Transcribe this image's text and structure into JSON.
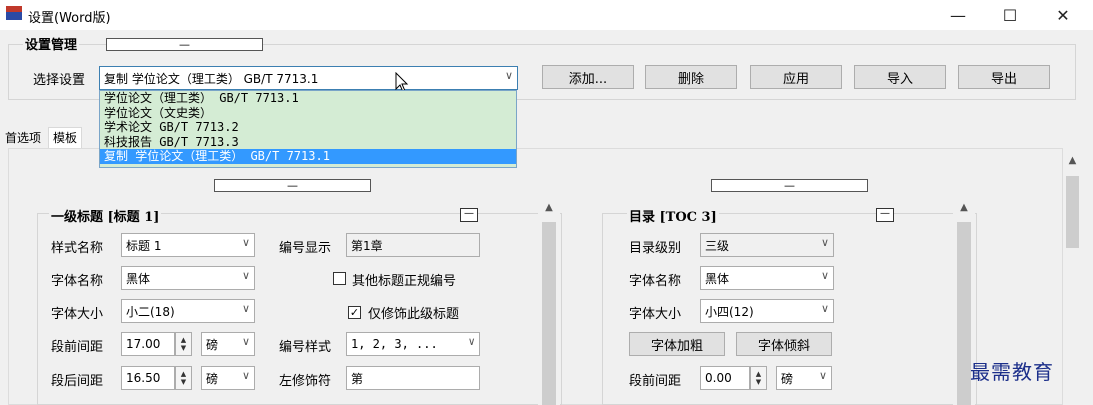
{
  "window": {
    "title": "设置(Word版)",
    "min_glyph": "—",
    "max_glyph": "☐",
    "close_glyph": "✕"
  },
  "manage": {
    "heading": "设置管理",
    "collapse_glyph": "—",
    "select_label": "选择设置",
    "selected_value": "复制 学位论文（理工类） GB/T 7713.1",
    "buttons": {
      "add": "添加...",
      "delete": "删除",
      "apply": "应用",
      "import": "导入",
      "export": "导出"
    }
  },
  "dropdown": {
    "options": [
      "学位论文（理工类） GB/T 7713.1",
      "学位论文（文史类）",
      "学术论文 GB/T 7713.2",
      "科技报告 GB/T 7713.3",
      "复制 学位论文（理工类） GB/T 7713.1"
    ],
    "selected_index": 4
  },
  "tabs": [
    "首选项",
    "模板"
  ],
  "heading1": {
    "title": "一级标题 [标题 1]",
    "collapse_glyph": "—",
    "min_glyph": "—",
    "style_name_label": "样式名称",
    "style_name_value": "标题 1",
    "font_name_label": "字体名称",
    "font_name_value": "黑体",
    "font_size_label": "字体大小",
    "font_size_value": "小二(18)",
    "space_before_label": "段前间距",
    "space_before_value": "17.00",
    "space_before_unit": "磅",
    "space_after_label": "段后间距",
    "space_after_value": "16.50",
    "space_after_unit": "磅",
    "number_display_label": "编号显示",
    "number_display_value": "第1章",
    "other_heading_label": "其他标题正规编号",
    "other_heading_checked": false,
    "only_this_label": "仅修饰此级标题",
    "only_this_checked": true,
    "number_style_label": "编号样式",
    "number_style_value": "1, 2, 3, ...",
    "left_decor_label": "左修饰符",
    "left_decor_value": "第"
  },
  "toc": {
    "title": "目录 [TOC 3]",
    "collapse_glyph": "—",
    "min_glyph": "—",
    "level_label": "目录级别",
    "level_value": "三级",
    "font_name_label": "字体名称",
    "font_name_value": "黑体",
    "font_size_label": "字体大小",
    "font_size_value": "小四(12)",
    "bold_button": "字体加粗",
    "italic_button": "字体倾斜",
    "space_before_label": "段前间距",
    "space_before_value": "0.00",
    "space_before_unit": "磅"
  },
  "icons": {
    "app": "word-settings-icon",
    "dropdown_arrow": "chevron-down-icon",
    "scroll_up": "chevron-up-icon"
  },
  "watermark": "最需教育",
  "colors": {
    "dropdown_bg": "#d4ecd4",
    "selection": "#3399ff",
    "watermark": "#1c2f8a"
  }
}
